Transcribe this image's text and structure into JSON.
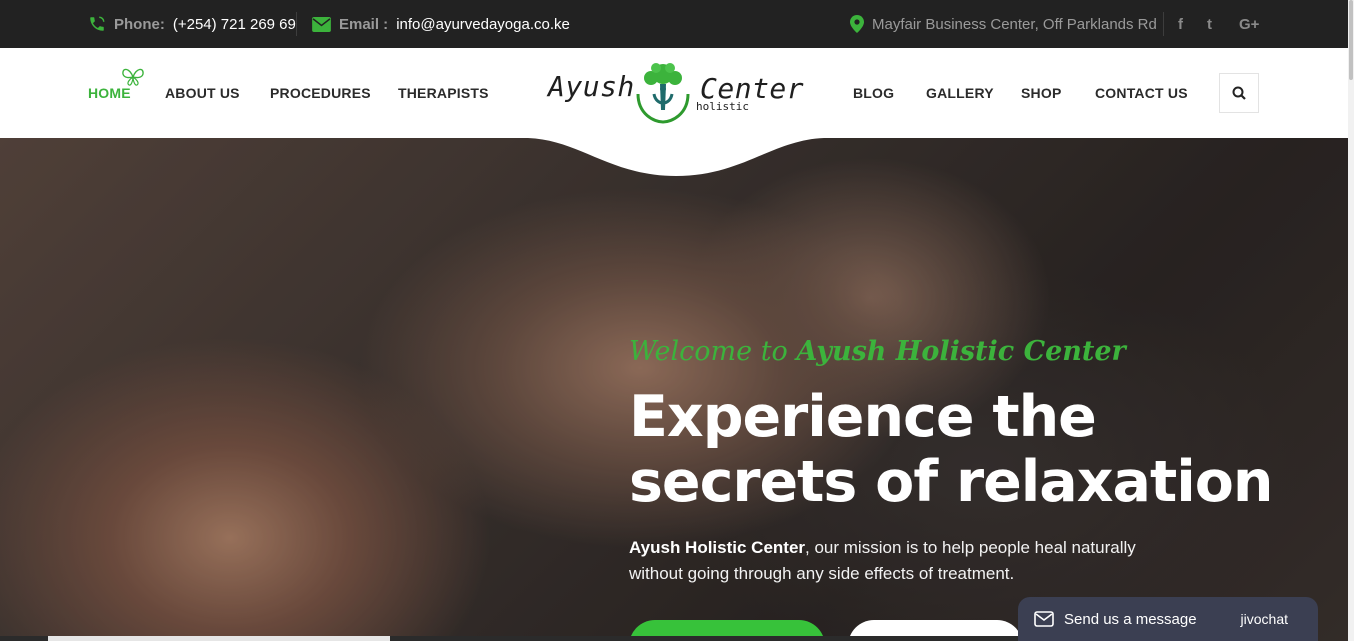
{
  "topbar": {
    "phone_label": "Phone:",
    "phone_value": "(+254) 721 269 69",
    "email_label": "Email :",
    "email_value": "info@ayurvedayoga.co.ke",
    "address": "Mayfair Business Center, Off Parklands Rd",
    "social": [
      {
        "icon": "facebook-icon",
        "glyph": "f"
      },
      {
        "icon": "twitter-icon",
        "glyph": "t"
      },
      {
        "icon": "google-plus-icon",
        "glyph": "G+"
      }
    ]
  },
  "nav": {
    "home": "HOME",
    "about": "ABOUT US",
    "procedures": "PROCEDURES",
    "therapists": "THERAPISTS",
    "blog": "BLOG",
    "gallery": "GALLERY",
    "shop": "SHOP",
    "contact": "CONTACT US"
  },
  "logo": {
    "word1": "Ayush",
    "word2": "Center",
    "sub": "holistic"
  },
  "hero": {
    "welcome_prefix": "Welcome to",
    "welcome_name": "Ayush Holistic Center",
    "title_line1": "Experience the",
    "title_line2": "secrets of relaxation",
    "text_bold": "Ayush Holistic Center",
    "text_rest": ", our mission is to help people heal naturally without going through any side effects of treatment."
  },
  "chat": {
    "label": "Send us a message",
    "brand": "jivochat"
  },
  "colors": {
    "accent": "#3cb33c",
    "topbar_bg": "#222222",
    "chat_bg": "#3b3f52"
  }
}
